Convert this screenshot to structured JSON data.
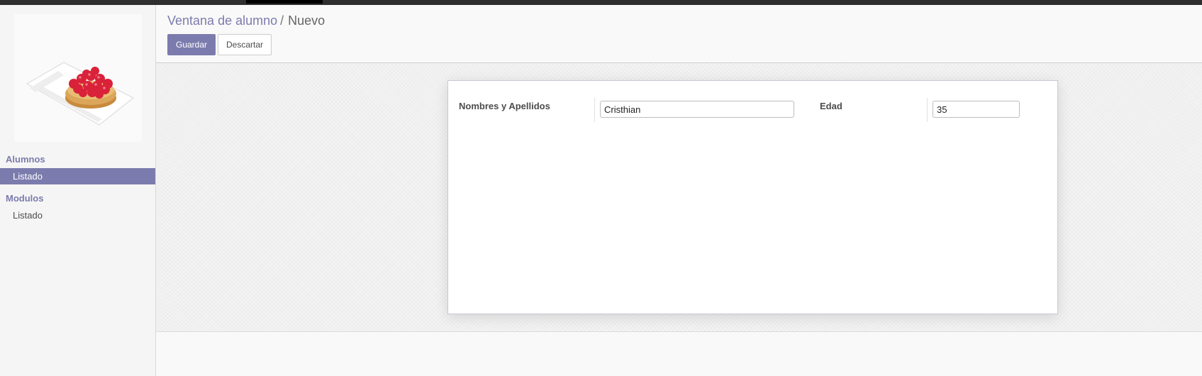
{
  "sidebar": {
    "logo_icon": "fruit-tart-icon",
    "sections": [
      {
        "title": "Alumnos",
        "items": [
          {
            "label": "Listado",
            "active": true
          }
        ]
      },
      {
        "title": "Modulos",
        "items": [
          {
            "label": "Listado",
            "active": false
          }
        ]
      }
    ]
  },
  "control_panel": {
    "breadcrumb_parent": "Ventana de alumno",
    "breadcrumb_separator": "/",
    "breadcrumb_current": "Nuevo",
    "save_label": "Guardar",
    "discard_label": "Descartar"
  },
  "form": {
    "name_label": "Nombres y Apellidos",
    "name_value": "Cristhian",
    "age_label": "Edad",
    "age_value": "35"
  },
  "colors": {
    "accent": "#7c7bad",
    "topbar": "#2f2f2f"
  }
}
